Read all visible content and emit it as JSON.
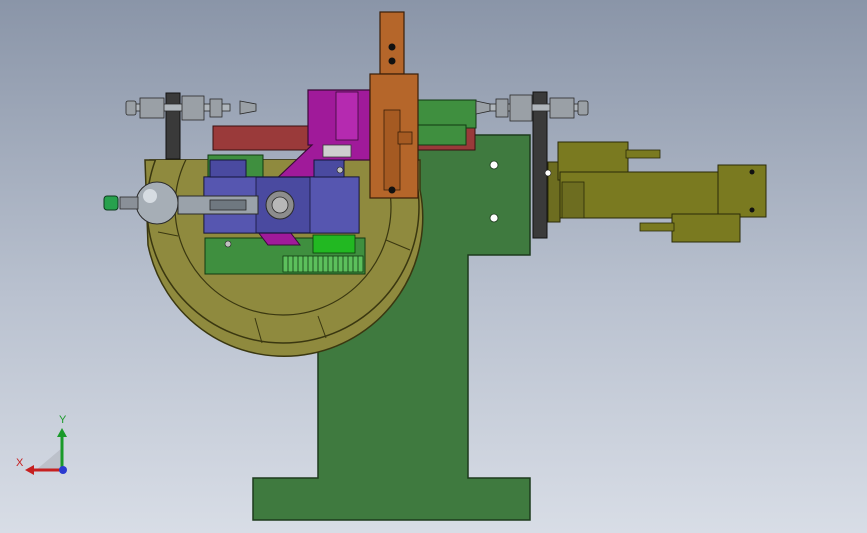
{
  "viewport": {
    "background_top": "#8a95a8",
    "background_bottom": "#d8dde6"
  },
  "triad": {
    "y_label": "Y",
    "x_label": "X",
    "y_color": "#1a9a2a",
    "x_color": "#c62020",
    "z_color": "#2a3ad0"
  },
  "model": {
    "base_color": "#3f7a3f",
    "turntable_color": "#8f8a3e",
    "clamp_block_color": "#4a4aa0",
    "bracket_color": "#a01a9a",
    "slider_color": "#b5662a",
    "rail_color": "#9a3a3a",
    "cylinder_color": "#7a7a20",
    "hardware_color": "#a0a8b0"
  }
}
